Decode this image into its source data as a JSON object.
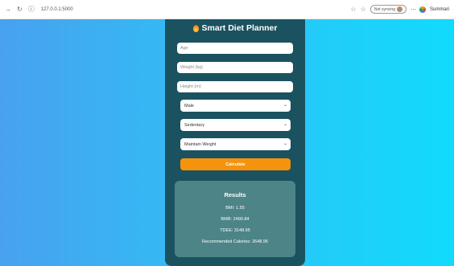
{
  "browser": {
    "url": "127.0.0.1:5000",
    "sync_label": "Not syncing",
    "summarize_label": "Summari"
  },
  "app": {
    "title": "Smart Diet Planner",
    "age_placeholder": "Age",
    "weight_placeholder": "Weight (kg)",
    "height_placeholder": "Height (m)",
    "gender_value": "Male",
    "activity_value": "Sedentary",
    "goal_value": "Maintain Weight",
    "calculate_label": "Calculate"
  },
  "results": {
    "title": "Results",
    "bmi": "BMI: 1.55",
    "bmr": "BMR: 2490.84",
    "tdee": "TDEE: 3148.95",
    "recommended": "Recommended Calories: 2648.95"
  }
}
